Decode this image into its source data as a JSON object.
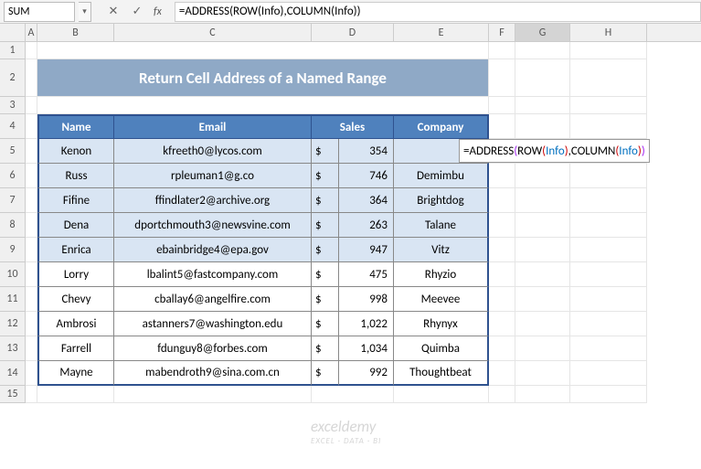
{
  "nameBox": "SUM",
  "formula": "=ADDRESS(ROW(Info),COLUMN(Info))",
  "formulaParts": {
    "p1": "=ADDRESS",
    "p2": "(",
    "p3": "ROW",
    "p4": "(",
    "p5": "Info",
    "p6": ")",
    "p7": ",COLUMN",
    "p8": "(",
    "p9": "Info",
    "p10": ")",
    "p11": ")"
  },
  "cols": {
    "a": "A",
    "b": "B",
    "c": "C",
    "d": "D",
    "e": "E",
    "f": "F",
    "g": "G",
    "h": "H"
  },
  "rowNums": [
    "1",
    "2",
    "3",
    "4",
    "5",
    "6",
    "7",
    "8",
    "9",
    "10",
    "11",
    "12",
    "13",
    "14",
    "15"
  ],
  "title": "Return Cell Address of a Named Range",
  "headers": {
    "name": "Name",
    "email": "Email",
    "sales": "Sales",
    "company": "Company"
  },
  "rows": [
    {
      "name": "Kenon",
      "email": "kfreeth0@lycos.com",
      "cur": "$",
      "sales": "354",
      "company": ""
    },
    {
      "name": "Russ",
      "email": "rpleuman1@g.co",
      "cur": "$",
      "sales": "746",
      "company": "Demimbu"
    },
    {
      "name": "Fifine",
      "email": "ffindlater2@archive.org",
      "cur": "$",
      "sales": "364",
      "company": "Brightdog"
    },
    {
      "name": "Dena",
      "email": "dportchmouth3@newsvine.com",
      "cur": "$",
      "sales": "263",
      "company": "Talane"
    },
    {
      "name": "Enrica",
      "email": "ebainbridge4@epa.gov",
      "cur": "$",
      "sales": "947",
      "company": "Vitz"
    },
    {
      "name": "Lorry",
      "email": "lbalint5@fastcompany.com",
      "cur": "$",
      "sales": "475",
      "company": "Rhyzio"
    },
    {
      "name": "Chevy",
      "email": "cballay6@angelfire.com",
      "cur": "$",
      "sales": "998",
      "company": "Meevee"
    },
    {
      "name": "Ambrosi",
      "email": "astanners7@washington.edu",
      "cur": "$",
      "sales": "1,022",
      "company": "Rhynyx"
    },
    {
      "name": "Farrell",
      "email": "fdunguy8@forbes.com",
      "cur": "$",
      "sales": "1,034",
      "company": "Quimba"
    },
    {
      "name": "Mayne",
      "email": "mabendroth9@sina.com.cn",
      "cur": "$",
      "sales": "992",
      "company": "Thoughtbeat"
    }
  ],
  "watermark": {
    "main": "exceldemy",
    "sub": "EXCEL · DATA · BI"
  }
}
